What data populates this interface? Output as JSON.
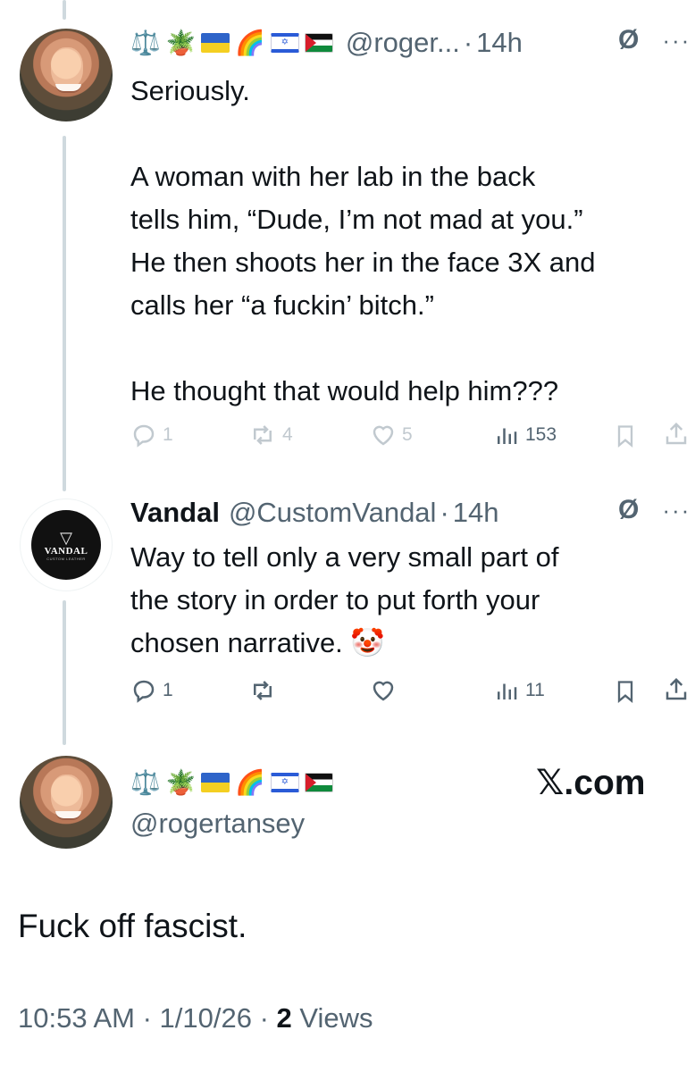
{
  "tweet1": {
    "flags": [
      "⚖️",
      "🪴",
      "ua-flag",
      "🌈",
      "il-flag",
      "ps-flag"
    ],
    "handle": "@roger...",
    "separator": "·",
    "time": "14h",
    "lines": [
      "Seriously.",
      "",
      "A woman with her lab in the back",
      "tells him, “Dude, I’m not mad at you.”",
      "He then shoots her in the face 3X and",
      "calls her “a fuckin’ bitch.”",
      "",
      "He thought that would help him???"
    ],
    "replies": "1",
    "reposts": "4",
    "likes": "5",
    "views": "153"
  },
  "tweet2": {
    "display_name": "Vandal",
    "handle": "@CustomVandal",
    "separator": "·",
    "time": "14h",
    "avatar_text": "VANDAL",
    "avatar_subtext": "CUSTOM LEATHER",
    "lines": [
      "Way to tell only a very small part of",
      "the story in order to put forth your",
      "chosen narrative. 🤡"
    ],
    "replies": "1",
    "reposts": "",
    "likes": "",
    "views": "11"
  },
  "main_tweet": {
    "flags": [
      "⚖️",
      "🪴",
      "ua-flag",
      "🌈",
      "il-flag",
      "ps-flag"
    ],
    "handle": "@rogertansey",
    "brand": "𝕏.com",
    "text": "Fuck off fascist.",
    "timestamp": "10:53 AM · 1/10/26 · ",
    "views_count": "2",
    "views_label": " Views"
  },
  "icons": {
    "reply": "reply-icon",
    "repost": "repost-icon",
    "like": "heart-icon",
    "views": "views-icon",
    "bookmark": "bookmark-icon",
    "share": "share-icon",
    "grok": "grok-icon",
    "more": "more-icon"
  },
  "colors": {
    "text": "#0f1419",
    "secondary": "#536471",
    "faded": "#c1c9cf",
    "thread_line": "#cfd9de"
  }
}
